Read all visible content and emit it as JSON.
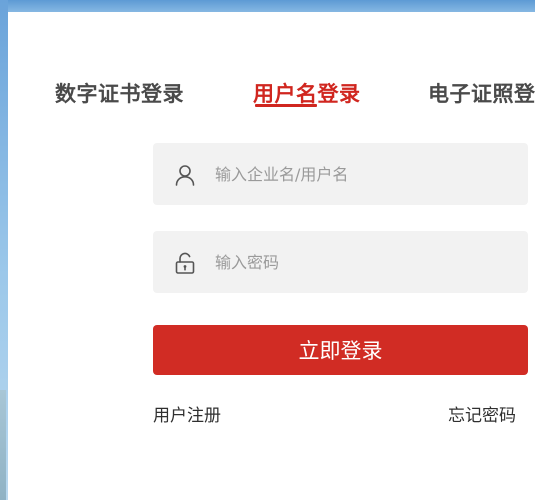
{
  "tabs": [
    {
      "label": "数字证书登录",
      "active": false
    },
    {
      "label": "用户名登录",
      "active": true
    },
    {
      "label": "电子证照登",
      "active": false
    }
  ],
  "form": {
    "username": {
      "value": "",
      "placeholder": "输入企业名/用户名",
      "icon": "user-icon"
    },
    "password": {
      "value": "",
      "placeholder": "输入密码",
      "icon": "lock-icon"
    },
    "submit_label": "立即登录",
    "register_label": "用户注册",
    "forgot_label": "忘记密码"
  },
  "colors": {
    "accent": "#d12c24",
    "field_bg": "#f2f2f2",
    "tab_text": "#4a4a4a"
  }
}
